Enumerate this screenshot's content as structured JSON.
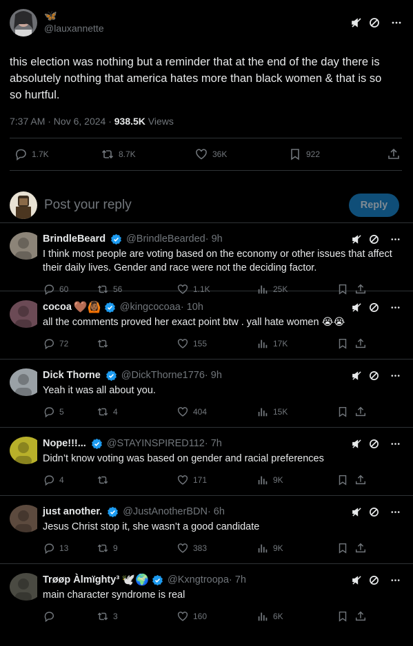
{
  "post": {
    "author_emoji": "🦋",
    "handle": "@lauxannette",
    "text": "this election was nothing but a reminder that at the end of the day there is absolutely nothing that america hates more than black women & that is so so hurtful.",
    "time": "7:37 AM · Nov 6, 2024 · ",
    "views_count": "938.5K",
    "views_label": " Views",
    "stats": {
      "replies": "1.7K",
      "reposts": "8.7K",
      "likes": "36K",
      "bookmarks": "922"
    }
  },
  "reply_box": {
    "placeholder": "Post your reply",
    "button": "Reply"
  },
  "replies": [
    {
      "name": "BrindleBeard",
      "emoji": "",
      "handle": "@BrindleBearded",
      "age": " · 9h",
      "text": "I think most people are voting based on the economy or other issues that affect their daily lives. Gender and race were not the deciding factor.",
      "replies": "60",
      "reposts": "56",
      "likes": "1.1K",
      "views": "25K",
      "avatar_color": "#8c8478"
    },
    {
      "name": "cocoa",
      "emoji": "🤎🙆🏾",
      "handle": "@kingcocoaa",
      "age": " · 10h",
      "text": "all the comments proved her exact point btw . yall hate women 😭😭",
      "replies": "72",
      "reposts": "",
      "likes": "155",
      "views": "17K",
      "avatar_color": "#6b4a55"
    },
    {
      "name": "Dick Thorne",
      "emoji": "",
      "handle": "@DickThorne1776",
      "age": " · 9h",
      "text": "Yeah it was all about you.",
      "replies": "5",
      "reposts": "4",
      "likes": "404",
      "views": "15K",
      "avatar_color": "#9aa1a6"
    },
    {
      "name": "Nope!!!...",
      "emoji": "",
      "handle": "@STAYINSPIRED112",
      "age": " · 7h",
      "text": "Didn’t know voting was based on gender and racial preferences",
      "replies": "4",
      "reposts": "",
      "likes": "171",
      "views": "9K",
      "avatar_color": "#b8b02a"
    },
    {
      "name": "just another.",
      "emoji": "",
      "handle": "@JustAnotherBDN",
      "age": " · 6h",
      "text": "Jesus Christ stop it, she wasn’t a good candidate",
      "replies": "13",
      "reposts": "9",
      "likes": "383",
      "views": "9K",
      "avatar_color": "#5c4a3e"
    },
    {
      "name": "Trøøp Àlmïghty³",
      "emoji": "🕊️🌍",
      "handle": "@Kxngtroopa",
      "age": " · 7h",
      "text": "main character syndrome is real",
      "replies": "",
      "reposts": "3",
      "likes": "160",
      "views": "6K",
      "avatar_color": "#4a4a42"
    }
  ],
  "colors": {
    "accent": "#1d9bf0",
    "muted": "#71767b",
    "text": "#e7e9ea",
    "divider": "#2f3336",
    "background": "#000000"
  }
}
